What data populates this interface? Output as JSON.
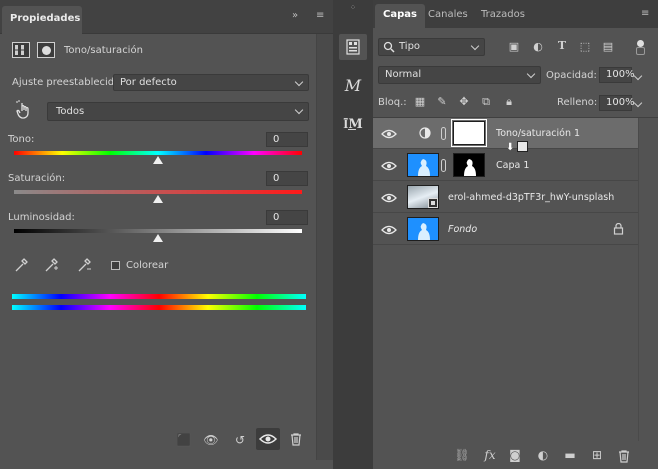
{
  "properties": {
    "tab_title": "Propiedades",
    "collapse_glyph": "»",
    "menu_glyph": "≡",
    "adjustment_name": "Tono/saturación",
    "preset_label": "Ajuste preestablecido:",
    "preset_value": "Por defecto",
    "channel_value": "Todos",
    "hue_label": "Tono:",
    "hue_value": "0",
    "saturation_label": "Saturación:",
    "saturation_value": "0",
    "lightness_label": "Luminosidad:",
    "lightness_value": "0",
    "colorize_label": "Colorear",
    "colorize_checked": false
  },
  "layers_panel": {
    "tabs": [
      {
        "label": "Capas",
        "active": true
      },
      {
        "label": "Canales",
        "active": false
      },
      {
        "label": "Trazados",
        "active": false
      }
    ],
    "filter_kind": "Tipo",
    "blend_mode": "Normal",
    "opacity_label": "Opacidad:",
    "opacity_value": "100%",
    "lock_label": "Bloq.:",
    "fill_label": "Relleno:",
    "fill_value": "100%",
    "layers": [
      {
        "name": "Tono/saturación 1",
        "type": "adjustment",
        "selected": true
      },
      {
        "name": "Capa 1",
        "type": "masked"
      },
      {
        "name": "erol-ahmed-d3pTF3r_hwY-unsplash",
        "type": "smart-object"
      },
      {
        "name": "Fondo",
        "type": "background",
        "italic": true,
        "locked": true
      }
    ]
  },
  "colors": {
    "panel_bg": "#535353",
    "tab_bar_bg": "#424242",
    "selected_layer_bg": "#6c6c6c",
    "input_bg": "#454545",
    "thumb_blue": "#1e90ff"
  }
}
